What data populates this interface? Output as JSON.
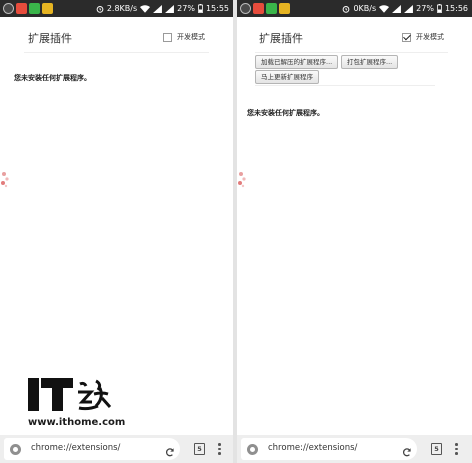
{
  "screens": [
    {
      "status": {
        "net_speed": "2.8KB/s",
        "battery": "27%",
        "time": "15:55"
      },
      "page": {
        "title": "扩展插件",
        "dev_mode_label": "开发模式",
        "dev_mode_checked": false,
        "empty_message": "您未安装任何扩展程序。"
      },
      "omnibox": {
        "url": "chrome://extensions/",
        "tab_count": "5"
      }
    },
    {
      "status": {
        "net_speed": "0KB/s",
        "battery": "27%",
        "time": "15:56"
      },
      "page": {
        "title": "扩展插件",
        "dev_mode_label": "开发模式",
        "dev_mode_checked": true,
        "buttons": {
          "load_unpacked": "加载已解压的扩展程序...",
          "pack": "打包扩展程序...",
          "update_now": "马上更新扩展程序"
        },
        "empty_message": "您未安装任何扩展程序。"
      },
      "omnibox": {
        "url": "chrome://extensions/",
        "tab_count": "5"
      }
    }
  ],
  "watermark": {
    "logo_text": "IT之家",
    "site": "www.ithome.com"
  },
  "icons": {
    "status_left": [
      "alarm-app-icon",
      "gallery-app-icon",
      "green-app-icon",
      "yellow-app-icon"
    ],
    "status_right": [
      "alarm-clock-icon",
      "wifi-icon",
      "signal-icon",
      "battery-icon"
    ],
    "omnibox": [
      "site-info-icon",
      "reload-icon",
      "tab-switcher-icon",
      "overflow-menu-icon"
    ]
  }
}
